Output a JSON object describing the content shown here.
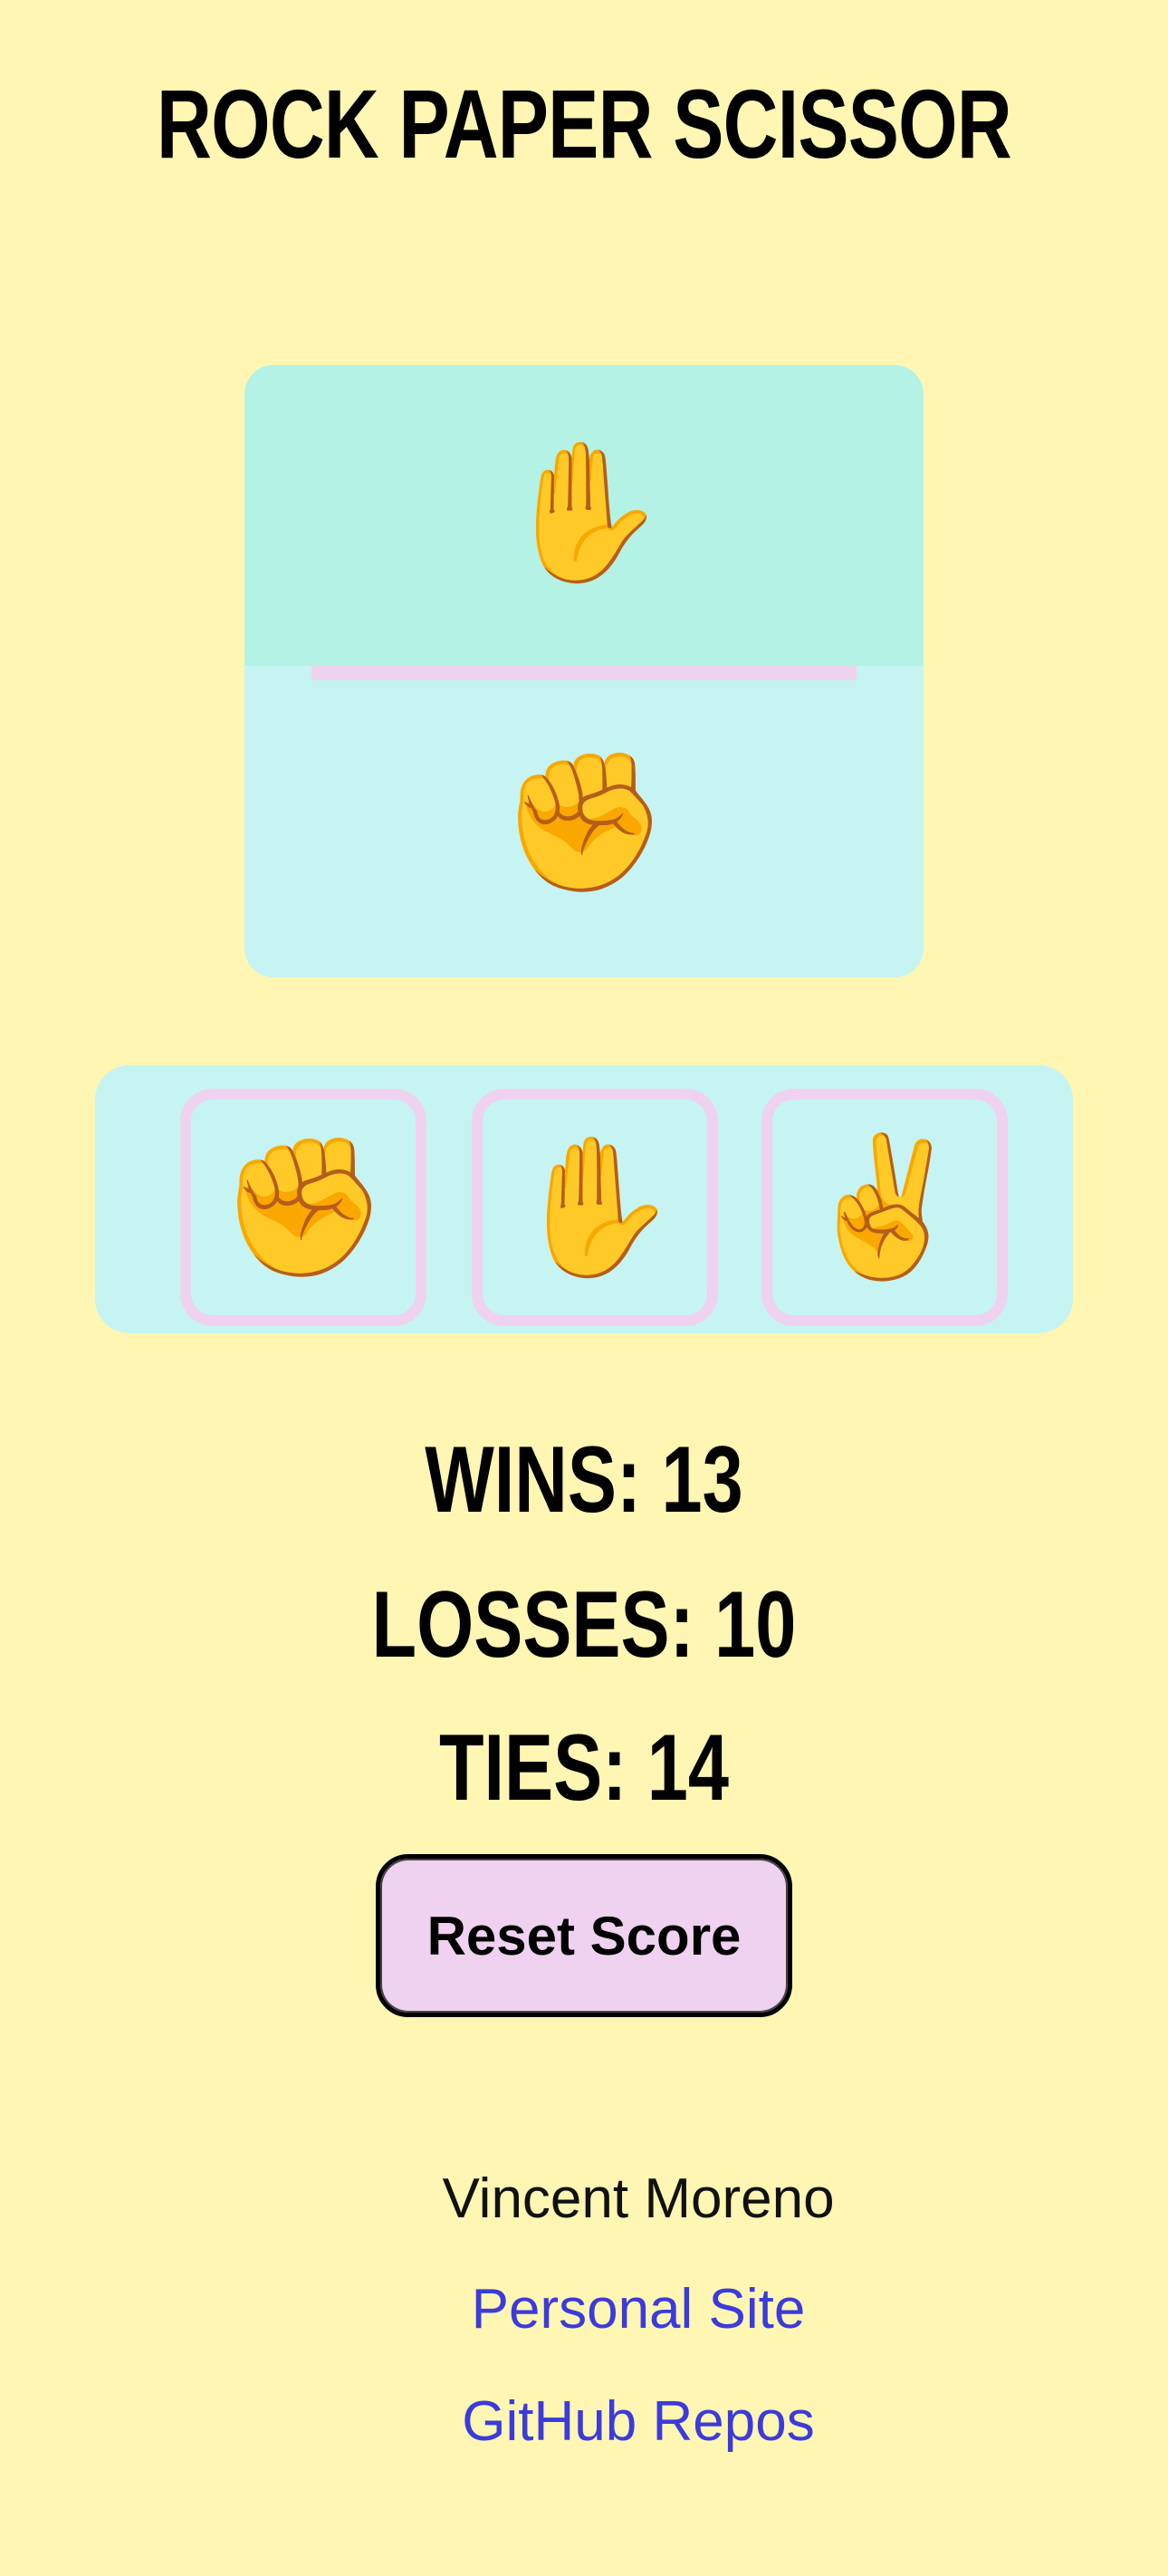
{
  "header": {
    "title": "ROCK PAPER SCISSOR"
  },
  "arena": {
    "cpu_choice_icon": "paper-hand-icon",
    "cpu_choice_glyph": "✋",
    "player_choice_icon": "rock-fist-icon",
    "player_choice_glyph": "✊"
  },
  "choices": [
    {
      "name": "rock",
      "glyph": "✊",
      "icon": "rock-fist-icon"
    },
    {
      "name": "paper",
      "glyph": "✋",
      "icon": "paper-hand-icon"
    },
    {
      "name": "scissors",
      "glyph": "✌️",
      "icon": "scissors-victory-hand-icon"
    }
  ],
  "score": {
    "wins_text": "WINS: 13",
    "losses_text": "LOSSES: 10",
    "ties_text": "TIES: 14",
    "wins": 13,
    "losses": 10,
    "ties": 14
  },
  "reset_button": {
    "label": "Reset Score"
  },
  "footer": {
    "name": "Vincent Moreno",
    "personal_site_label": "Personal Site",
    "github_label": "GitHub Repos"
  },
  "colors": {
    "background": "#fff6b3",
    "arena_top": "#b3f2e5",
    "arena_bottom": "#c6f4f2",
    "accent_pink": "#efd2ef",
    "link": "#3b3bdc"
  }
}
